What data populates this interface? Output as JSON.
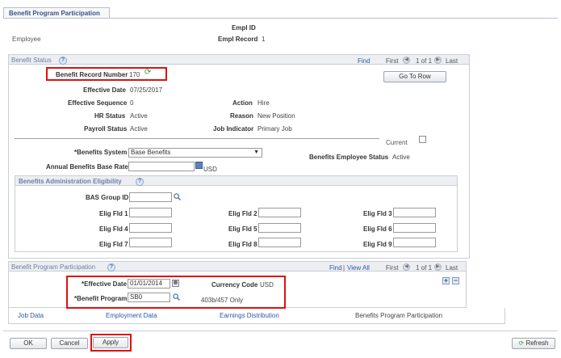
{
  "tab": {
    "label": "Benefit Program Participation"
  },
  "header": {
    "empl_id_label": "Empl ID",
    "employee_label": "Employee",
    "empl_record_label": "Empl Record",
    "empl_record_value": "1"
  },
  "benefit_status": {
    "title": "Benefit Status",
    "find": "Find",
    "first": "First",
    "counter": "1 of 1",
    "last": "Last",
    "record_number_label": "Benefit Record Number",
    "record_number_value": "170",
    "go_to_row": "Go To Row",
    "effective_date_label": "Effective Date",
    "effective_date_value": "07/25/2017",
    "effective_sequence_label": "Effective Sequence",
    "effective_sequence_value": "0",
    "action_label": "Action",
    "action_value": "Hire",
    "hr_status_label": "HR Status",
    "hr_status_value": "Active",
    "reason_label": "Reason",
    "reason_value": "New Position",
    "payroll_status_label": "Payroll Status",
    "payroll_status_value": "Active",
    "job_indicator_label": "Job Indicator",
    "job_indicator_value": "Primary Job",
    "current_label": "Current",
    "benefits_system_label": "*Benefits System",
    "benefits_system_value": "Base Benefits",
    "employee_status_label": "Benefits Employee Status",
    "employee_status_value": "Active",
    "base_rate_label": "Annual Benefits Base Rate",
    "base_rate_currency": "USD"
  },
  "eligibility": {
    "title": "Benefits Administration Eligibility",
    "bas_group_label": "BAS Group ID",
    "fields": [
      {
        "label": "Elig Fld 1"
      },
      {
        "label": "Elig Fld 2"
      },
      {
        "label": "Elig Fld 3"
      },
      {
        "label": "Elig Fld 4"
      },
      {
        "label": "Elig Fld 5"
      },
      {
        "label": "Elig Fld 6"
      },
      {
        "label": "Elig Fld 7"
      },
      {
        "label": "Elig Fld 8"
      },
      {
        "label": "Elig Fld 9"
      }
    ]
  },
  "program": {
    "title": "Benefit Program Participation",
    "find": "Find",
    "view_all": "View All",
    "first": "First",
    "counter": "1 of 1",
    "last": "Last",
    "effective_date_label": "*Effective Date",
    "effective_date_value": "01/01/2014",
    "currency_label": "Currency Code",
    "currency_value": "USD",
    "program_label": "*Benefit Program",
    "program_value": "SB0",
    "program_desc": "403b/457 Only"
  },
  "footer_links": [
    "Job Data",
    "Employment Data",
    "Earnings Distribution",
    "Benefits Program Participation"
  ],
  "buttons": {
    "ok": "OK",
    "cancel": "Cancel",
    "apply": "Apply",
    "refresh": "Refresh"
  },
  "colors": {
    "accent_link": "#2a5aa8",
    "highlight": "#e01010",
    "section_title": "#6b7fa8"
  }
}
